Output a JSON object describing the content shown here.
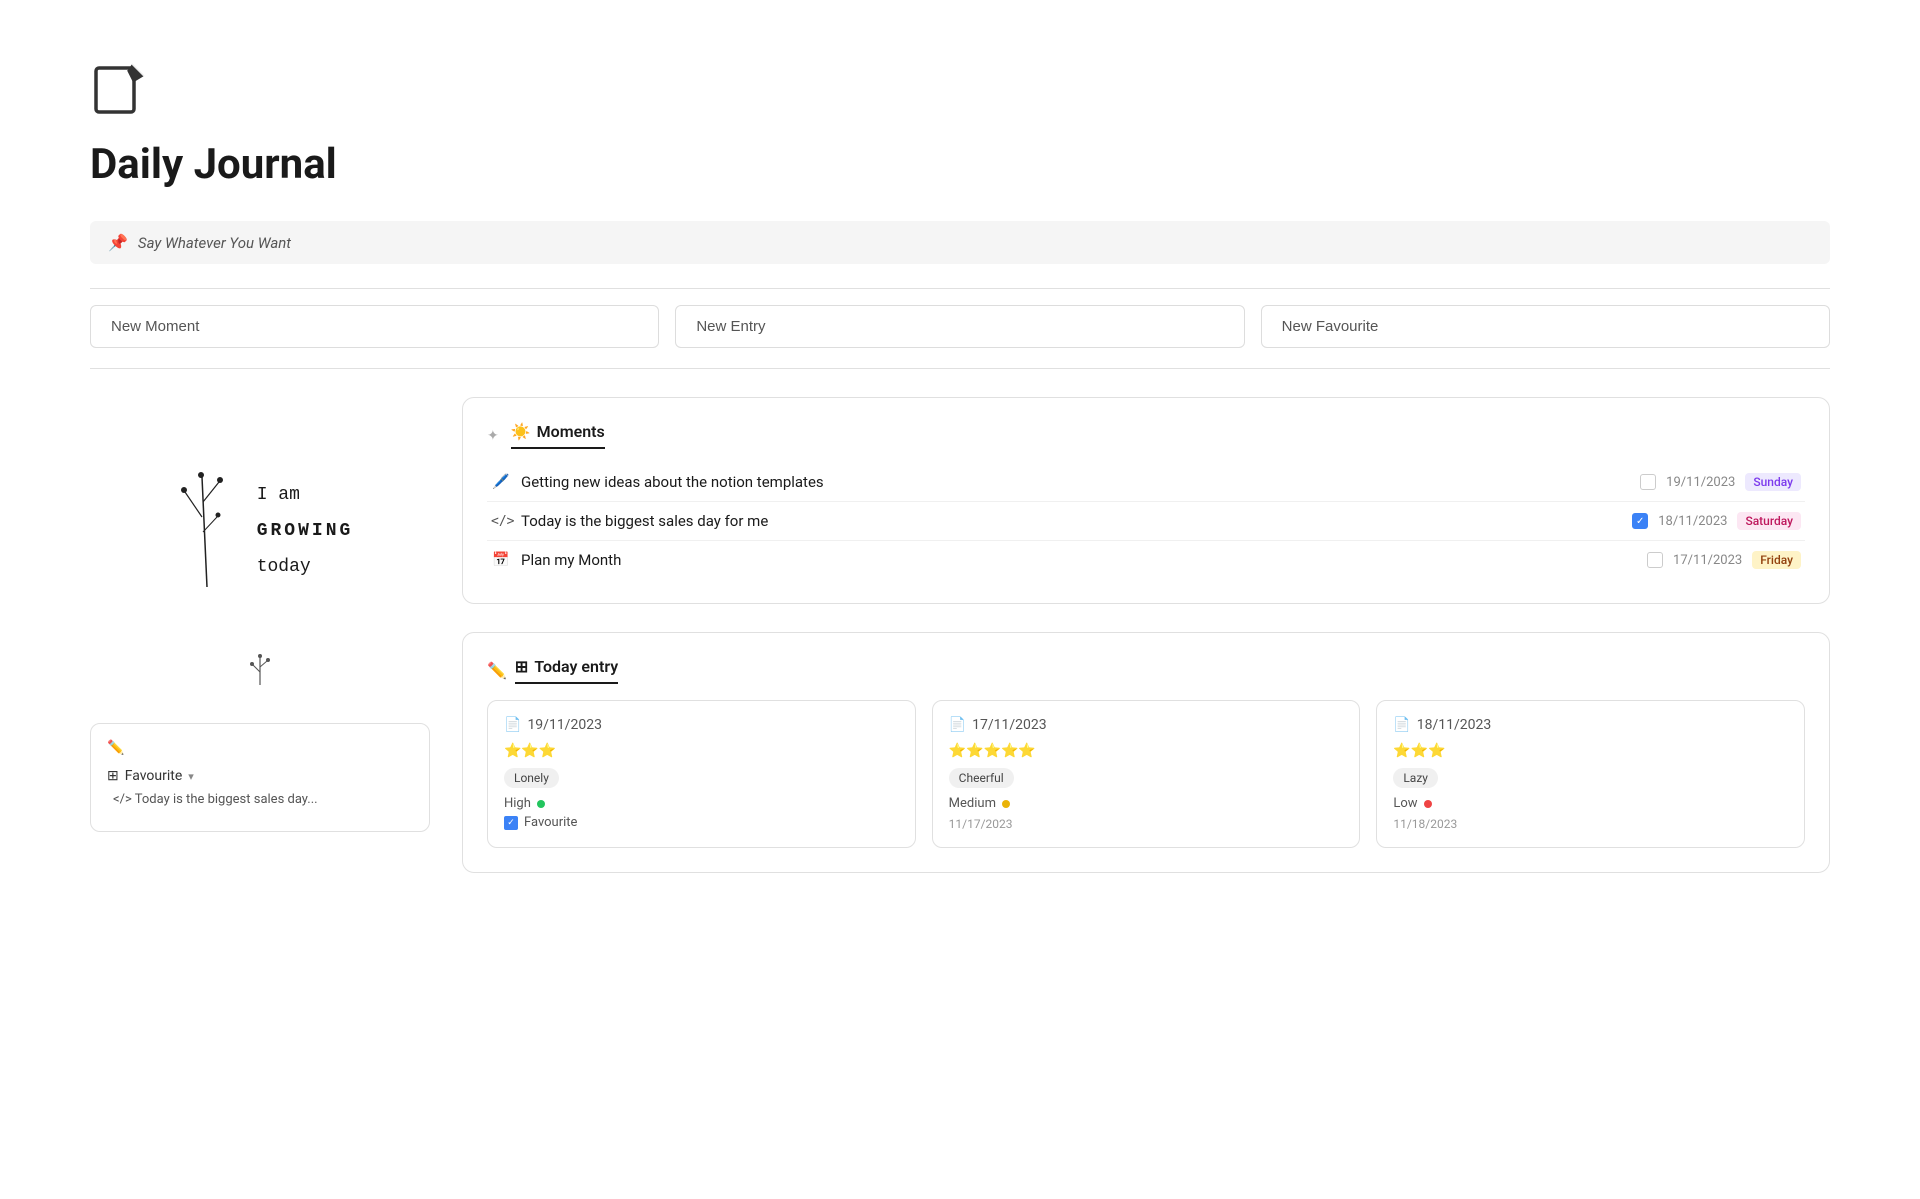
{
  "page": {
    "title": "Daily Journal",
    "icon_label": "edit-journal-icon"
  },
  "pinned": {
    "text": "Say Whatever You Want"
  },
  "new_buttons": {
    "moment": "New Moment",
    "entry": "New Entry",
    "favourite": "New Favourite"
  },
  "moments_section": {
    "title": "Moments",
    "title_icon": "☀️",
    "move_icon": "✦",
    "items": [
      {
        "icon": "🖊️",
        "icon_type": "pen-icon",
        "text": "Getting new ideas about the notion templates",
        "checked": false,
        "date": "19/11/2023",
        "day": "Sunday",
        "day_class": "day-sunday"
      },
      {
        "icon": "</>",
        "icon_type": "code-icon",
        "text": "Today is the biggest sales day for me",
        "checked": true,
        "date": "18/11/2023",
        "day": "Saturday",
        "day_class": "day-saturday"
      },
      {
        "icon": "📅",
        "icon_type": "calendar-icon",
        "text": "Plan my Month",
        "checked": false,
        "date": "17/11/2023",
        "day": "Friday",
        "day_class": "day-friday"
      }
    ]
  },
  "today_entry_section": {
    "title": "Today entry",
    "title_icon": "⊞",
    "edit_icon": "✏️",
    "entries": [
      {
        "date": "19/11/2023",
        "stars": "⭐⭐⭐",
        "mood": "Lonely",
        "energy_label": "High",
        "energy_dot": "green",
        "has_favourite": true,
        "favourite_label": "Favourite",
        "bottom_date": ""
      },
      {
        "date": "17/11/2023",
        "stars": "⭐⭐⭐⭐⭐",
        "mood": "Cheerful",
        "energy_label": "Medium",
        "energy_dot": "yellow",
        "has_favourite": false,
        "favourite_label": "",
        "bottom_date": "11/17/2023"
      },
      {
        "date": "18/11/2023",
        "stars": "⭐⭐⭐",
        "mood": "Lazy",
        "energy_label": "Low",
        "energy_dot": "red",
        "has_favourite": false,
        "favourite_label": "",
        "bottom_date": "11/18/2023"
      }
    ]
  },
  "illustration": {
    "handwriting_line1": "I am",
    "handwriting_line2": "GROWING",
    "handwriting_line3": "today"
  },
  "favourite_card": {
    "label": "Favourite",
    "preview_text": "</> Today is the biggest sales day..."
  }
}
